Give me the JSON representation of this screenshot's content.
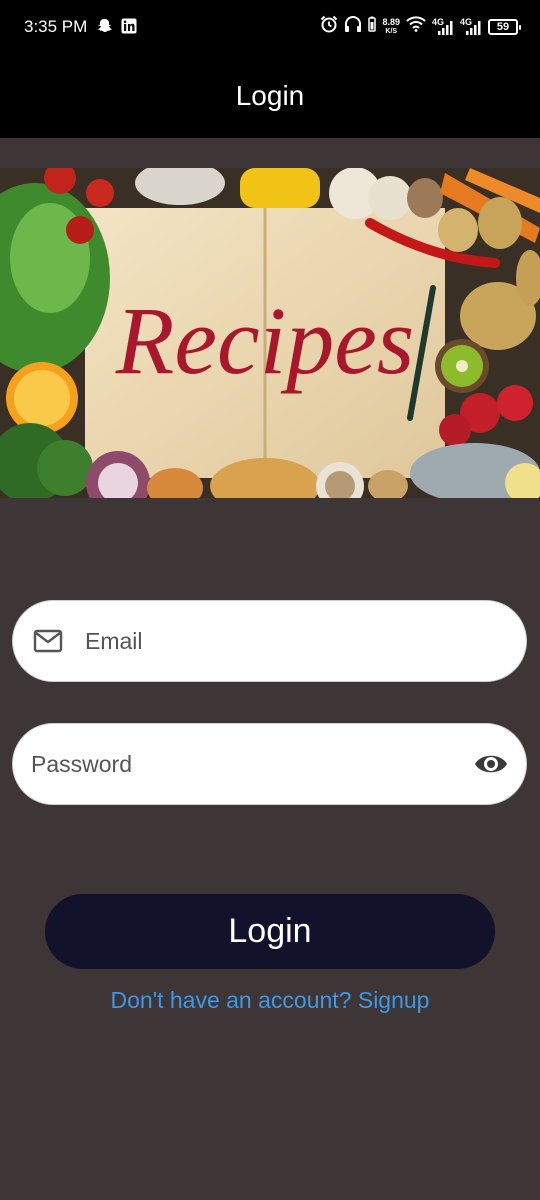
{
  "status_bar": {
    "time": "3:35 PM",
    "net_speed_value": "8.89",
    "net_speed_unit": "K/S",
    "network_1": "4G",
    "network_2": "4G",
    "battery": "59"
  },
  "app_bar": {
    "title": "Login"
  },
  "banner": {
    "text": "Recipes"
  },
  "form": {
    "email_label": "Email",
    "password_label": "Password",
    "login_button": "Login",
    "signup_link": "Don't have an account? Signup"
  },
  "colors": {
    "background": "#3e3536",
    "button": "#12122a",
    "link": "#3d98e6"
  }
}
